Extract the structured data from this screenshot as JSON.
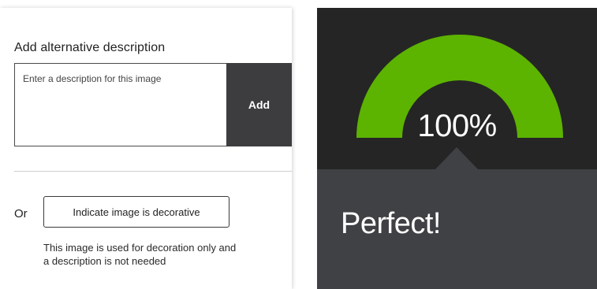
{
  "alt_description": {
    "heading": "Add alternative description",
    "input_value": "",
    "input_placeholder": "Enter a description for this image",
    "add_label": "Add"
  },
  "decorative": {
    "or_label": "Or",
    "button_label": "Indicate image is decorative",
    "help_text": "This image is used for decoration only and a description is not needed"
  },
  "score": {
    "percent": 100,
    "value_label": "100%",
    "message": "Perfect!",
    "colors": {
      "gauge_fill": "#5cb300",
      "panel_bg": "#252525",
      "message_bg": "#404144"
    }
  }
}
